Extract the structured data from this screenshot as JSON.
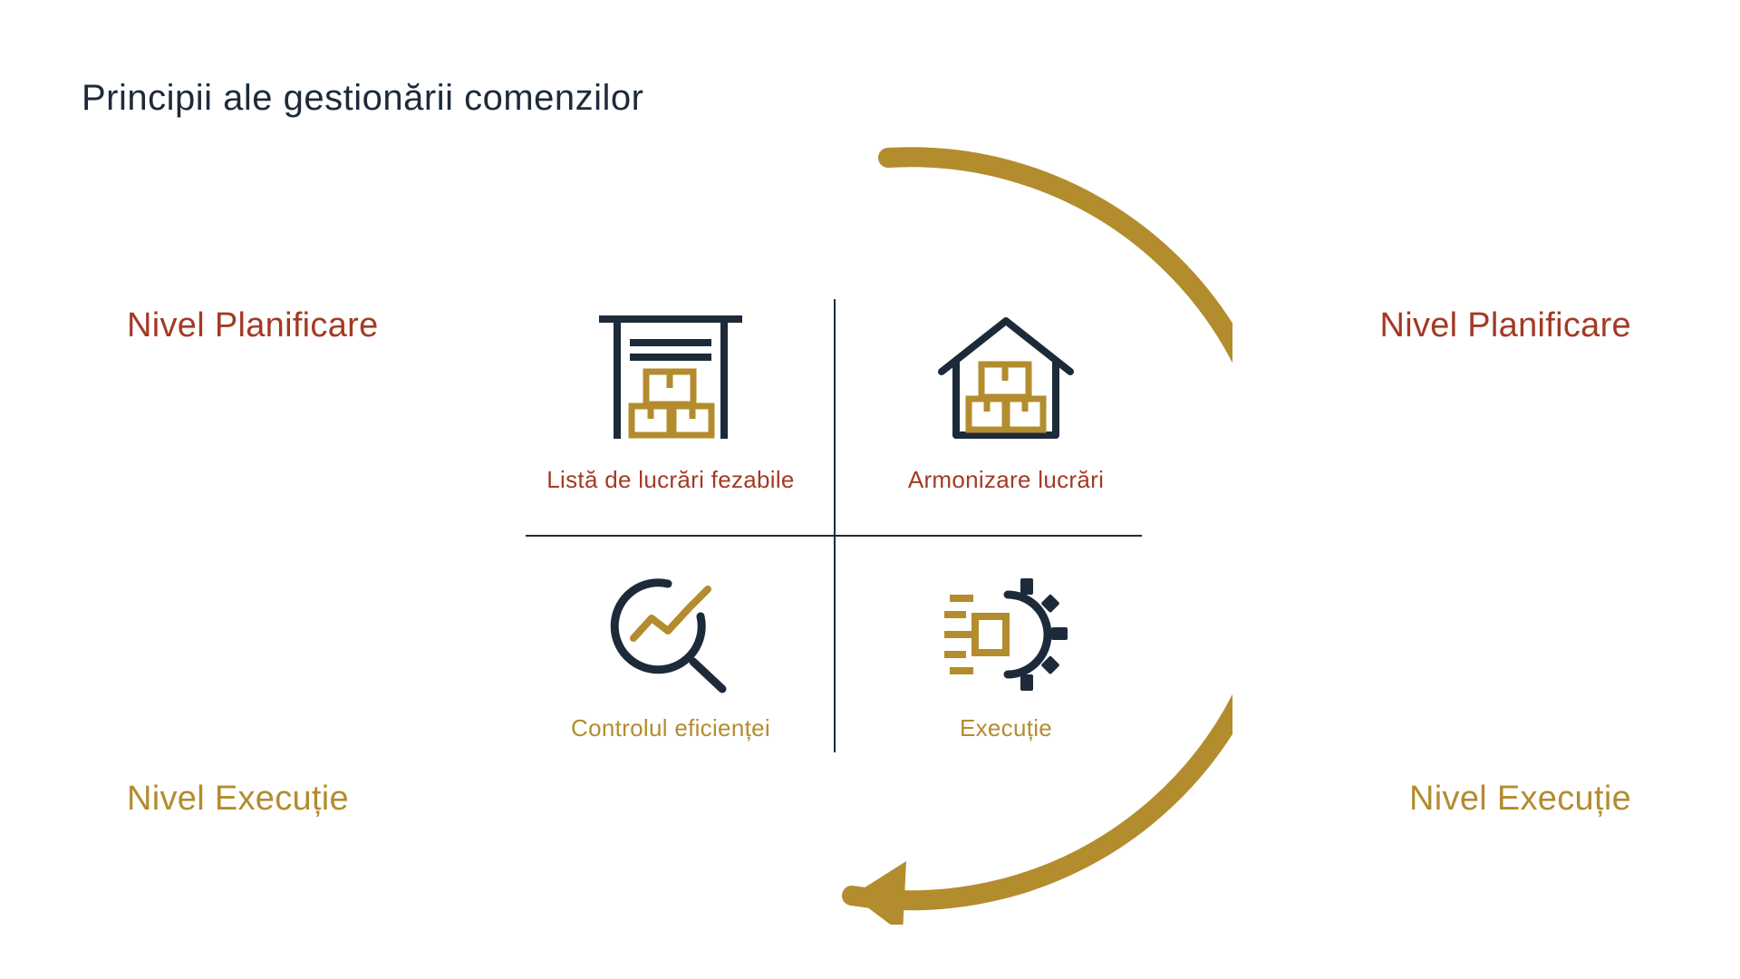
{
  "title": "Principii ale gestionării comenzilor",
  "colors": {
    "dark": "#1d2a3a",
    "red": "#a33a25",
    "gold": "#b38c2e"
  },
  "corners": {
    "top_left": "Nivel Planificare",
    "top_right": "Nivel Planificare",
    "bottom_left": "Nivel Execuție",
    "bottom_right": "Nivel Execuție"
  },
  "quadrants": {
    "top_left": {
      "label": "Listă de lucrări fezabile",
      "icon": "warehouse-dock-icon"
    },
    "top_right": {
      "label": "Armonizare lucrări",
      "icon": "warehouse-house-icon"
    },
    "bottom_left": {
      "label": "Controlul eficienței",
      "icon": "magnifier-chart-icon"
    },
    "bottom_right": {
      "label": "Execuție",
      "icon": "gear-process-icon"
    }
  }
}
